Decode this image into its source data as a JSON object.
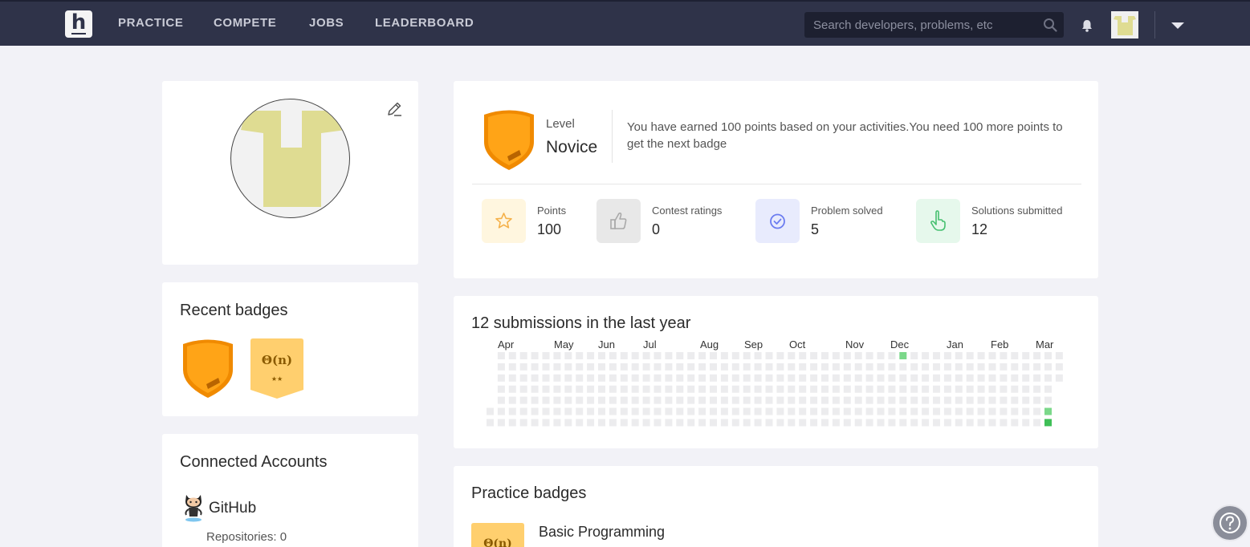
{
  "nav": {
    "items": [
      "PRACTICE",
      "COMPETE",
      "JOBS",
      "LEADERBOARD"
    ],
    "search_placeholder": "Search developers, problems, etc"
  },
  "level": {
    "label": "Level",
    "value": "Novice",
    "description": "You have earned 100 points based on your activities.You need 100 more points to get the next badge"
  },
  "stats": [
    {
      "label": "Points",
      "value": "100",
      "icon": "star-icon"
    },
    {
      "label": "Contest ratings",
      "value": "0",
      "icon": "thumbs-up-icon"
    },
    {
      "label": "Problem solved",
      "value": "5",
      "icon": "check-circle-icon"
    },
    {
      "label": "Solutions submitted",
      "value": "12",
      "icon": "pointer-hand-icon"
    }
  ],
  "recent_badges": {
    "title": "Recent badges",
    "items": [
      {
        "type": "shield",
        "text": ""
      },
      {
        "type": "complexity",
        "text": "Θ(n)",
        "stars": "★★"
      }
    ]
  },
  "connected_accounts": {
    "title": "Connected Accounts",
    "github_label": "GitHub",
    "repositories": "Repositories: 0"
  },
  "submissions": {
    "title": "12 submissions in the last year",
    "months": [
      "Apr",
      "May",
      "Jun",
      "Jul",
      "Aug",
      "Sep",
      "Oct",
      "Nov",
      "Dec",
      "Jan",
      "Feb",
      "Mar"
    ],
    "active_cells": [
      {
        "week": 37,
        "day": 0,
        "level": 1
      },
      {
        "week": 50,
        "day": 5,
        "level": 1
      },
      {
        "week": 50,
        "day": 6,
        "level": 2
      }
    ],
    "colors": {
      "empty": "#ececee",
      "level1": "#7bd88a",
      "level2": "#3fbf57"
    }
  },
  "practice_badges": {
    "title": "Practice badges",
    "first_badge": "Basic Programming",
    "first_badge_text": "Θ(n)"
  },
  "colors": {
    "navbar": "#2f3349",
    "shield_orange": "#ff9e0b",
    "badge_yellow": "#ffcf6e",
    "avatar_yellow": "#dfdc92"
  }
}
